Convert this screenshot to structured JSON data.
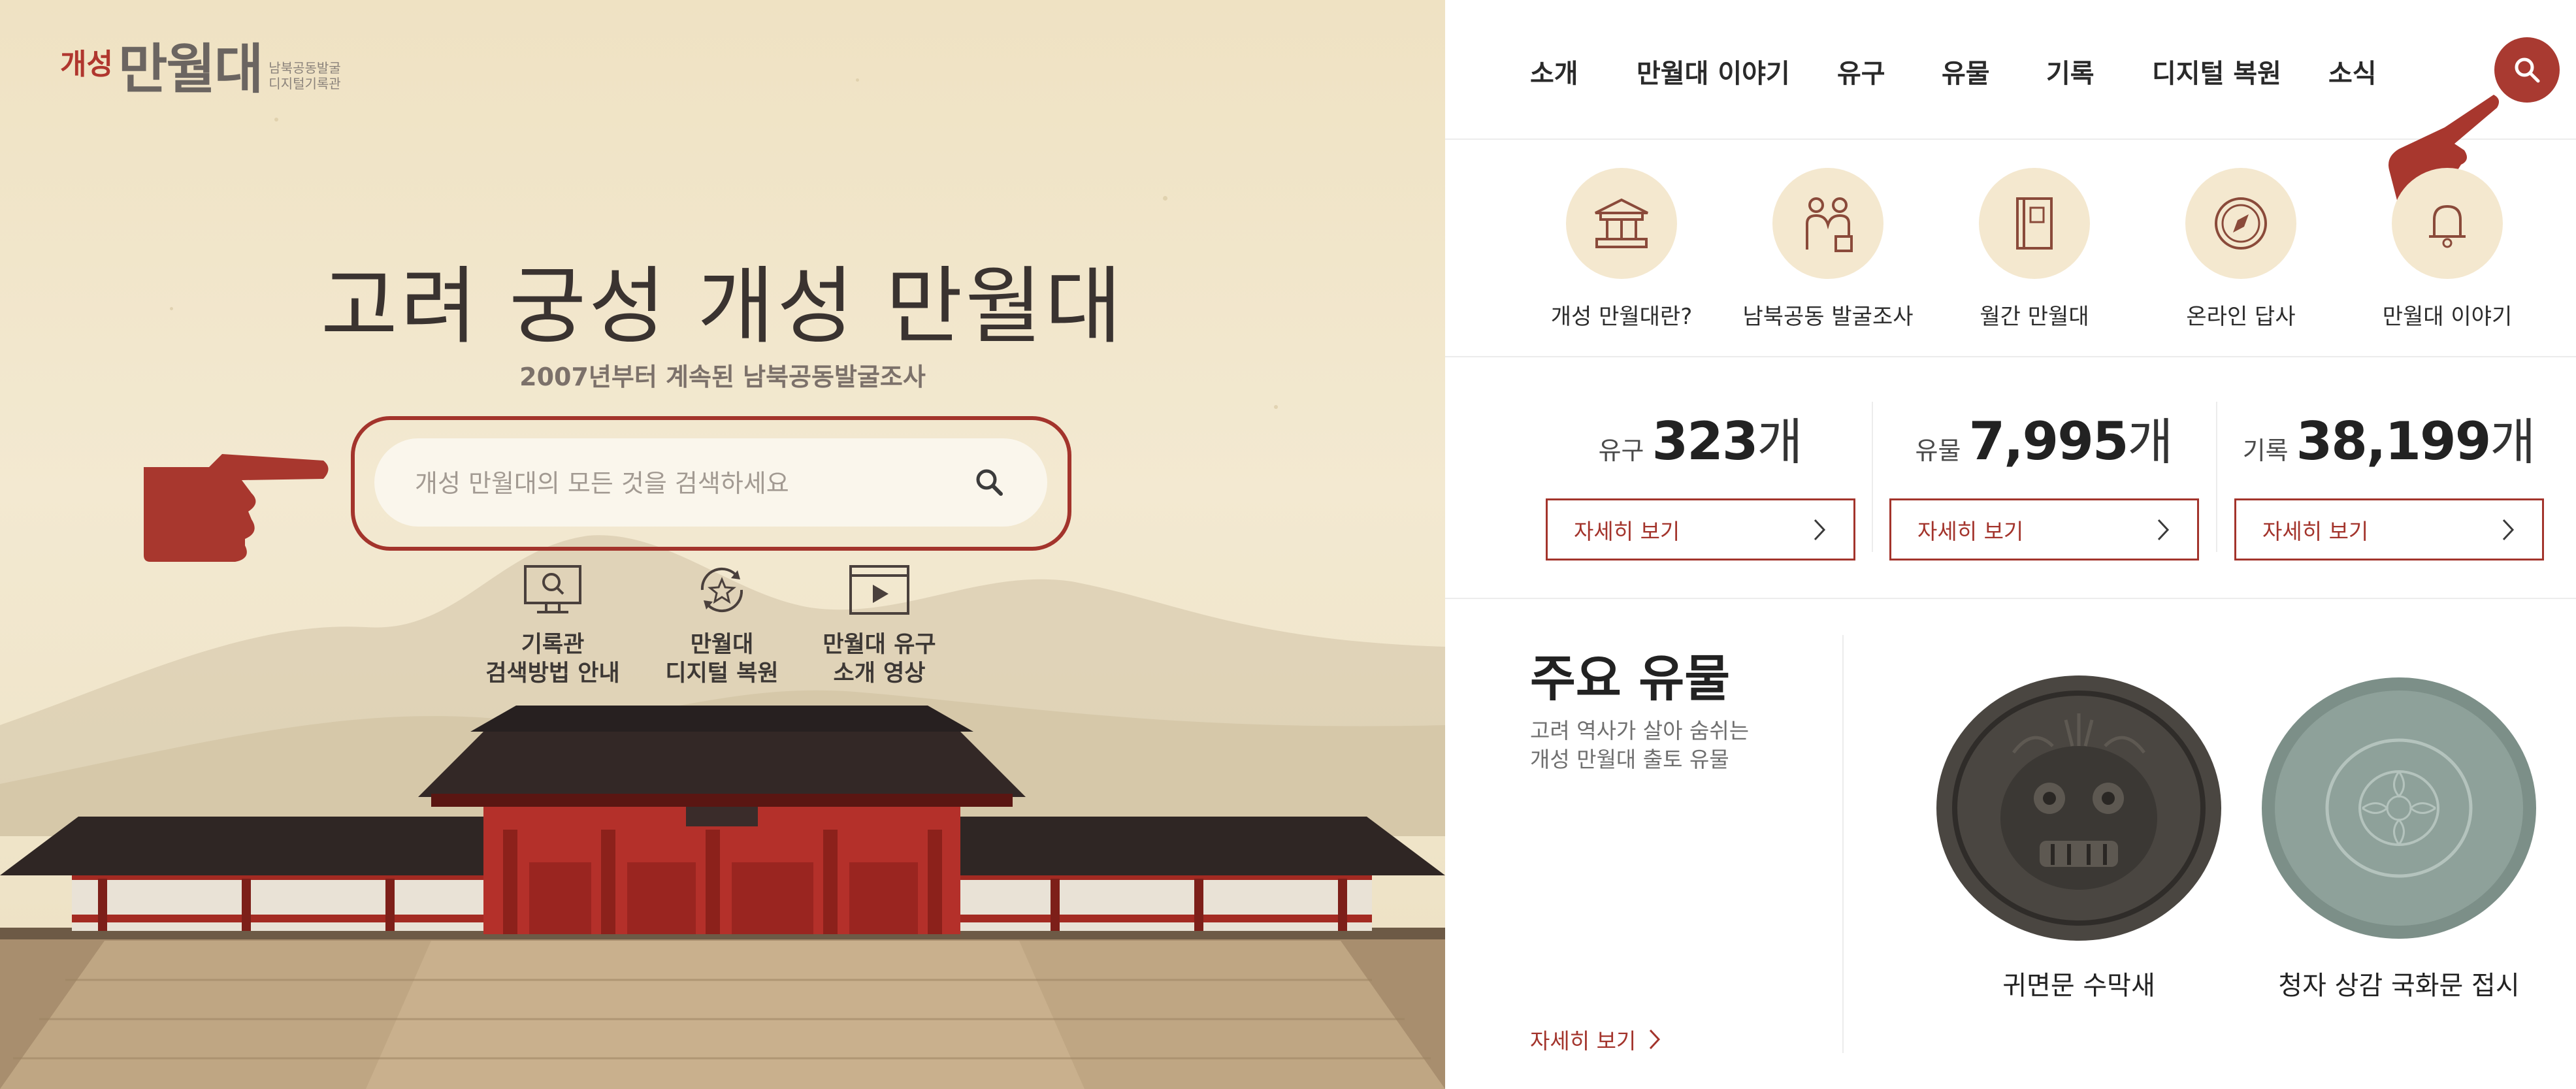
{
  "logo": {
    "prefix": "개성",
    "name": "만월대",
    "sub_line1": "남북공동발굴",
    "sub_line2": "디지털기록관"
  },
  "hero": {
    "title": "고려 궁성 개성 만월대",
    "subtitle": "2007년부터 계속된 남북공동발굴조사",
    "search_placeholder": "개성 만월대의 모든 것을 검색하세요"
  },
  "quick_links": [
    {
      "label": "기록관\n검색방법 안내",
      "icon": "monitor-search-icon"
    },
    {
      "label": "만월대\n디지털 복원",
      "icon": "star-refresh-icon"
    },
    {
      "label": "만월대 유구\n소개 영상",
      "icon": "video-play-icon"
    }
  ],
  "nav": {
    "items": [
      "소개",
      "만월대 이야기",
      "유구",
      "유물",
      "기록",
      "디지털 복원",
      "소식"
    ],
    "search_icon": "search-icon"
  },
  "categories": [
    {
      "label": "개성 만월대란?",
      "icon": "palace-icon"
    },
    {
      "label": "남북공동 발굴조사",
      "icon": "people-icon"
    },
    {
      "label": "월간 만월대",
      "icon": "book-icon"
    },
    {
      "label": "온라인 답사",
      "icon": "compass-icon"
    },
    {
      "label": "만월대 이야기",
      "icon": "bell-icon"
    }
  ],
  "stats": [
    {
      "name": "유구",
      "count": "323",
      "unit": "개",
      "button": "자세히 보기"
    },
    {
      "name": "유물",
      "count": "7,995",
      "unit": "개",
      "button": "자세히 보기"
    },
    {
      "name": "기록",
      "count": "38,199",
      "unit": "개",
      "button": "자세히 보기"
    }
  ],
  "feature": {
    "title": "주요 유물",
    "description": "고려 역사가 살아 숨쉬는\n개성 만월대 출토 유물",
    "more": "자세히 보기",
    "artifacts": [
      {
        "name": "귀면문 수막새"
      },
      {
        "name": "청자 상감 국화문 접시"
      }
    ]
  },
  "colors": {
    "accent": "#a3342c",
    "hero_bg": "#efe2c3",
    "circle_bg": "#f4e8cf"
  }
}
